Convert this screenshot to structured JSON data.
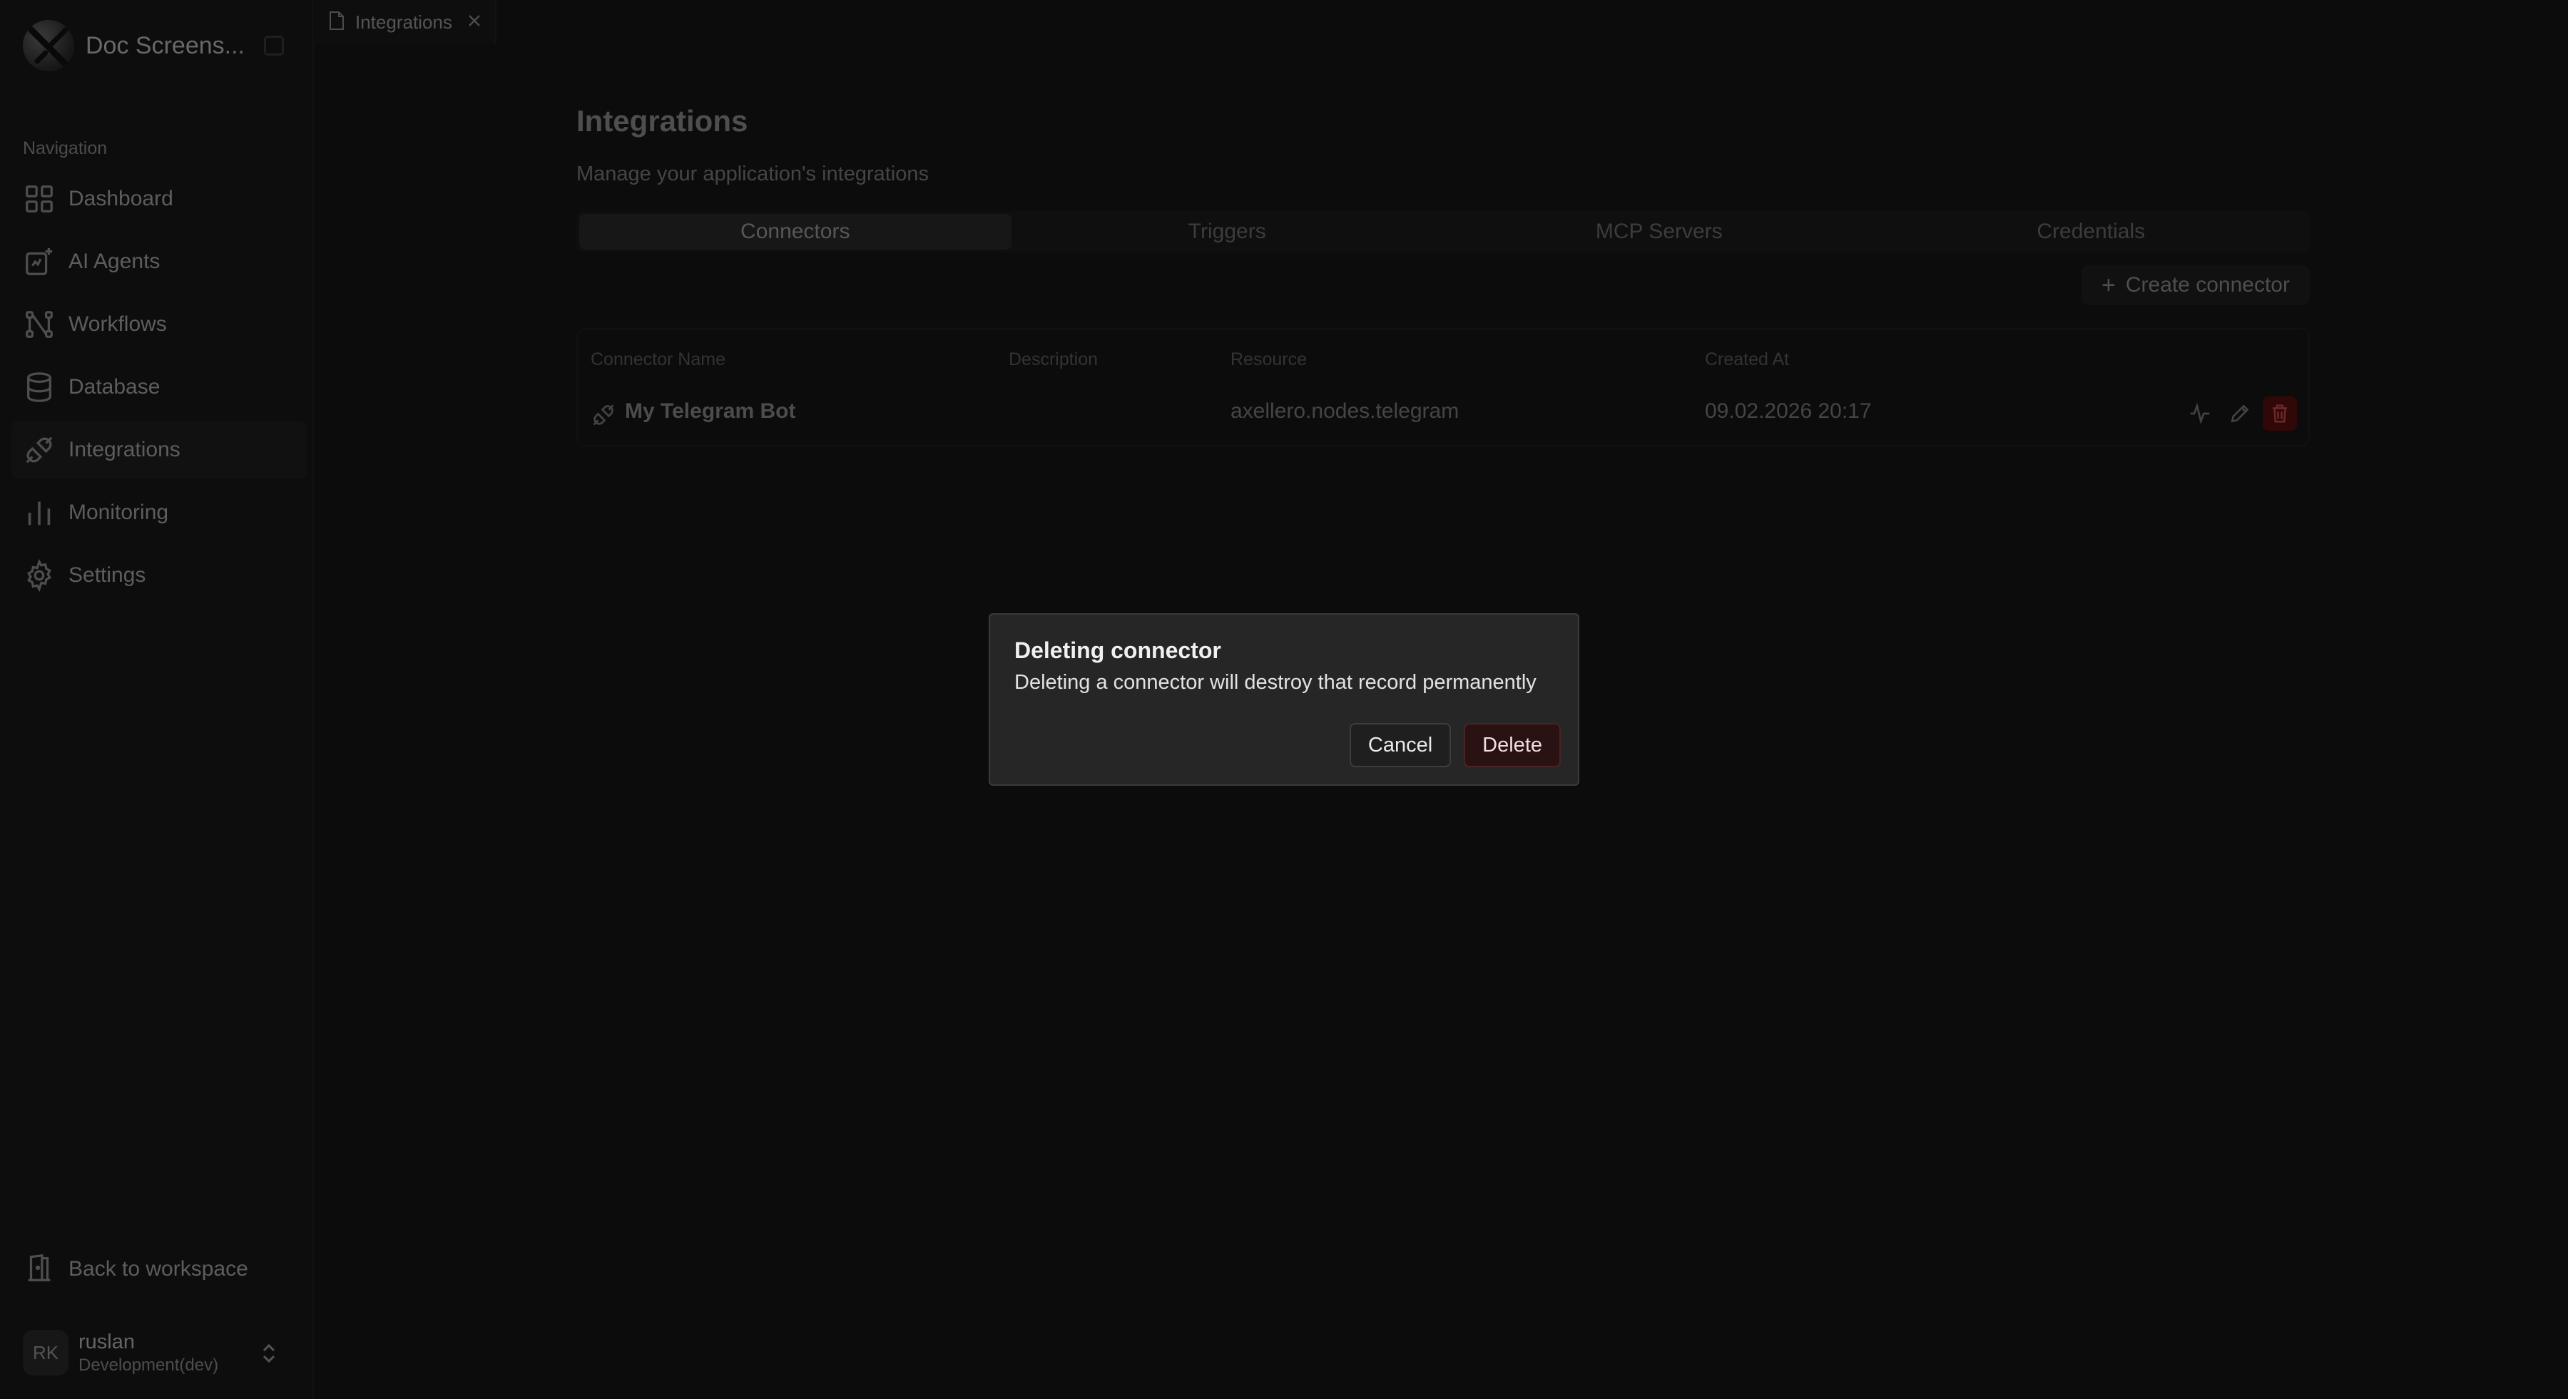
{
  "app": {
    "name": "Doc Screens..."
  },
  "sidebar": {
    "heading": "Navigation",
    "items": [
      {
        "label": "Dashboard",
        "icon": "dashboard-icon"
      },
      {
        "label": "AI Agents",
        "icon": "ai-agents-icon"
      },
      {
        "label": "Workflows",
        "icon": "workflow-icon"
      },
      {
        "label": "Database",
        "icon": "database-icon"
      },
      {
        "label": "Integrations",
        "icon": "plug-icon",
        "active": true
      },
      {
        "label": "Monitoring",
        "icon": "bar-chart-icon"
      },
      {
        "label": "Settings",
        "icon": "gear-icon"
      }
    ],
    "back_label": "Back to workspace",
    "user": {
      "initials": "RK",
      "name": "ruslan",
      "env": "Development(dev)"
    }
  },
  "tabbar": {
    "tabs": [
      {
        "label": "Integrations"
      }
    ]
  },
  "page": {
    "title": "Integrations",
    "subtitle": "Manage your application's integrations",
    "tabs": [
      "Connectors",
      "Triggers",
      "MCP Servers",
      "Credentials"
    ],
    "create_label": "Create connector"
  },
  "table": {
    "headers": [
      "Connector Name",
      "Description",
      "Resource",
      "Created At"
    ],
    "rows": [
      {
        "name": "My Telegram Bot",
        "description": "",
        "resource": "axellero.nodes.telegram",
        "created_at": "09.02.2026 20:17"
      }
    ]
  },
  "dialog": {
    "title": "Deleting connector",
    "text": "Deleting a connector will destroy that record permanently",
    "cancel_label": "Cancel",
    "delete_label": "Delete"
  },
  "colors": {
    "background": "#161616",
    "danger": "#5a0f0f",
    "dialog_bg": "#262627"
  }
}
